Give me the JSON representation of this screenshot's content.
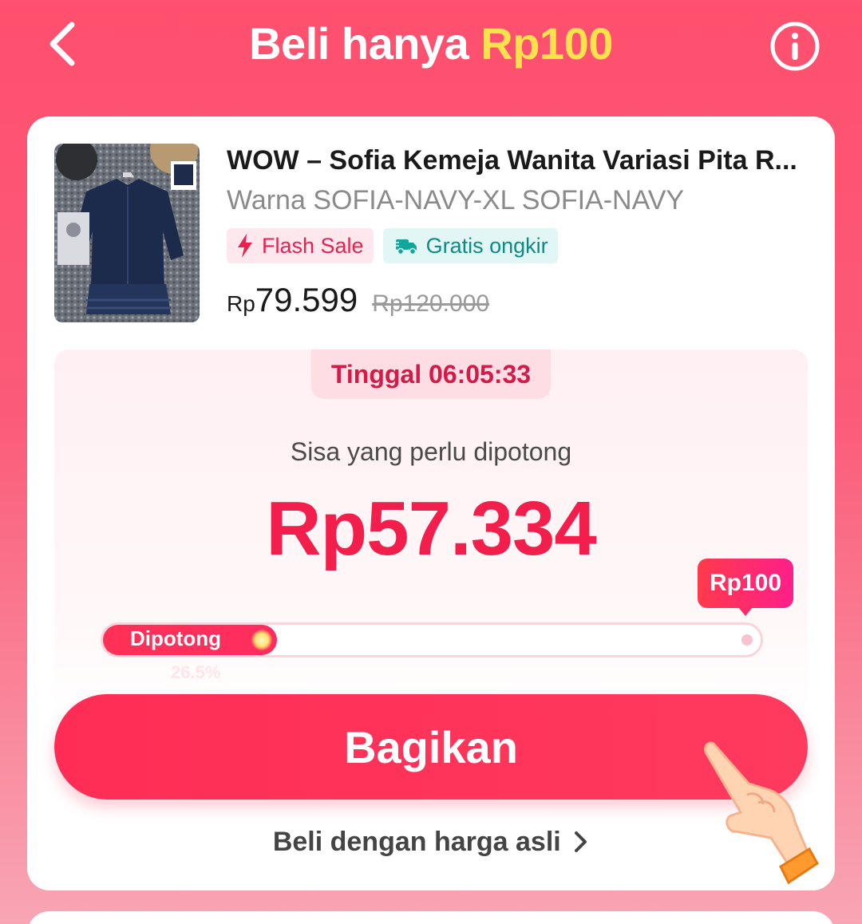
{
  "header": {
    "title_prefix": "Beli hanya ",
    "title_accent": "Rp100"
  },
  "product": {
    "name": "WOW – Sofia Kemeja Wanita Variasi Pita R...",
    "variant": "Warna SOFIA-NAVY-XL SOFIA-NAVY",
    "tags": {
      "flash_sale": "Flash Sale",
      "free_shipping": "Gratis ongkir"
    },
    "price_currency": "Rp",
    "price_value": "79.599",
    "price_original": "Rp120.000"
  },
  "campaign": {
    "timer": "Tinggal 06:05:33",
    "remaining_label": "Sisa yang perlu dipotong",
    "remaining_amount": "Rp57.334",
    "goal_label": "Rp100",
    "progress_label": "Dipotong",
    "progress_percent_text": "26.5%",
    "progress_fraction": 0.265
  },
  "actions": {
    "share_label": "Bagikan",
    "buy_original_label": "Beli dengan harga asli"
  },
  "colors": {
    "accent": "#f21f4d",
    "title_accent": "#ffe14d"
  }
}
